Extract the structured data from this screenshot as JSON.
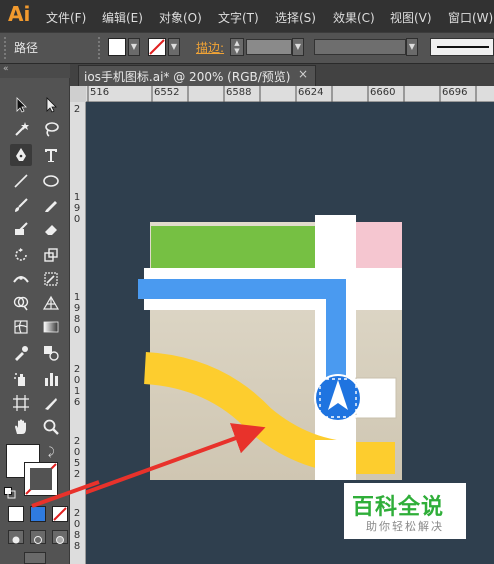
{
  "app": {
    "logo": "Ai"
  },
  "menu": [
    "文件(F)",
    "编辑(E)",
    "对象(O)",
    "文字(T)",
    "选择(S)",
    "效果(C)",
    "视图(V)",
    "窗口(W)"
  ],
  "control_bar": {
    "selection_label": "路径",
    "stroke_label": "描边:",
    "fill_color": "#ffffff",
    "stroke_color": "none"
  },
  "toolbar": {
    "collapse_glyph": "«"
  },
  "document": {
    "tab_title": "ios手机图标.ai* @ 200% (RGB/预览)",
    "close_glyph": "×"
  },
  "rulers": {
    "horizontal": [
      "516",
      "6552",
      "6588",
      "6624",
      "6660",
      "6696"
    ],
    "vertical": [
      "2",
      "1",
      "9",
      "0",
      "1",
      "9",
      "8",
      "0",
      "2",
      "0",
      "1",
      "6",
      "2",
      "0",
      "5",
      "2",
      "2",
      "0",
      "8",
      "8"
    ]
  },
  "artwork": {
    "colors": {
      "green": "#76c043",
      "pink": "#f5c6d0",
      "blue": "#4a9af0",
      "yellow": "#fdcd2e",
      "map_bg": "#ddd6c6",
      "white": "#ffffff",
      "arrow": "#e8322b",
      "pin": "#1f74e0"
    }
  },
  "watermark": {
    "title": "百科全说",
    "subtitle": "助你轻松解决"
  }
}
